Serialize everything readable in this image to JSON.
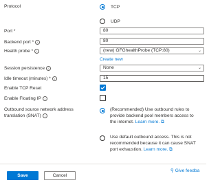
{
  "form": {
    "protocol": {
      "label": "Protocol",
      "options": [
        {
          "label": "TCP",
          "selected": true
        },
        {
          "label": "UDP",
          "selected": false
        }
      ]
    },
    "port": {
      "label": "Port *",
      "value": "80"
    },
    "backend_port": {
      "label": "Backend port *",
      "value": "80"
    },
    "health_probe": {
      "label": "Health probe *",
      "value": "(new) GFGhealthProbe (TCP:80)",
      "create_new": "Create new"
    },
    "session_persistence": {
      "label": "Session persistence",
      "value": "None"
    },
    "idle_timeout": {
      "label": "Idle timeout (minutes) *",
      "value": "15"
    },
    "tcp_reset": {
      "label": "Enable TCP Reset",
      "checked": true
    },
    "floating_ip": {
      "label": "Enable Floating IP",
      "checked": false
    },
    "snat": {
      "label_line1": "Outbound source network address",
      "label_line2": "translation (SNAT)",
      "option1": {
        "line1": "(Recommended) Use outbound rules to",
        "line2": "provide backend pool members access to",
        "line3": "the internet.",
        "link": "Learn more.",
        "selected": true
      },
      "option2": {
        "line1": "Use default outbound access. This is not",
        "line2": "recommended because it can cause SNAT",
        "line3": "port exhaustion.",
        "link": "Learn more.",
        "selected": false
      }
    }
  },
  "footer": {
    "save": "Save",
    "cancel": "Cancel",
    "feedback": "Give feedba"
  },
  "colors": {
    "accent": "#0078d4",
    "text": "#323130",
    "border": "#8a8886"
  }
}
